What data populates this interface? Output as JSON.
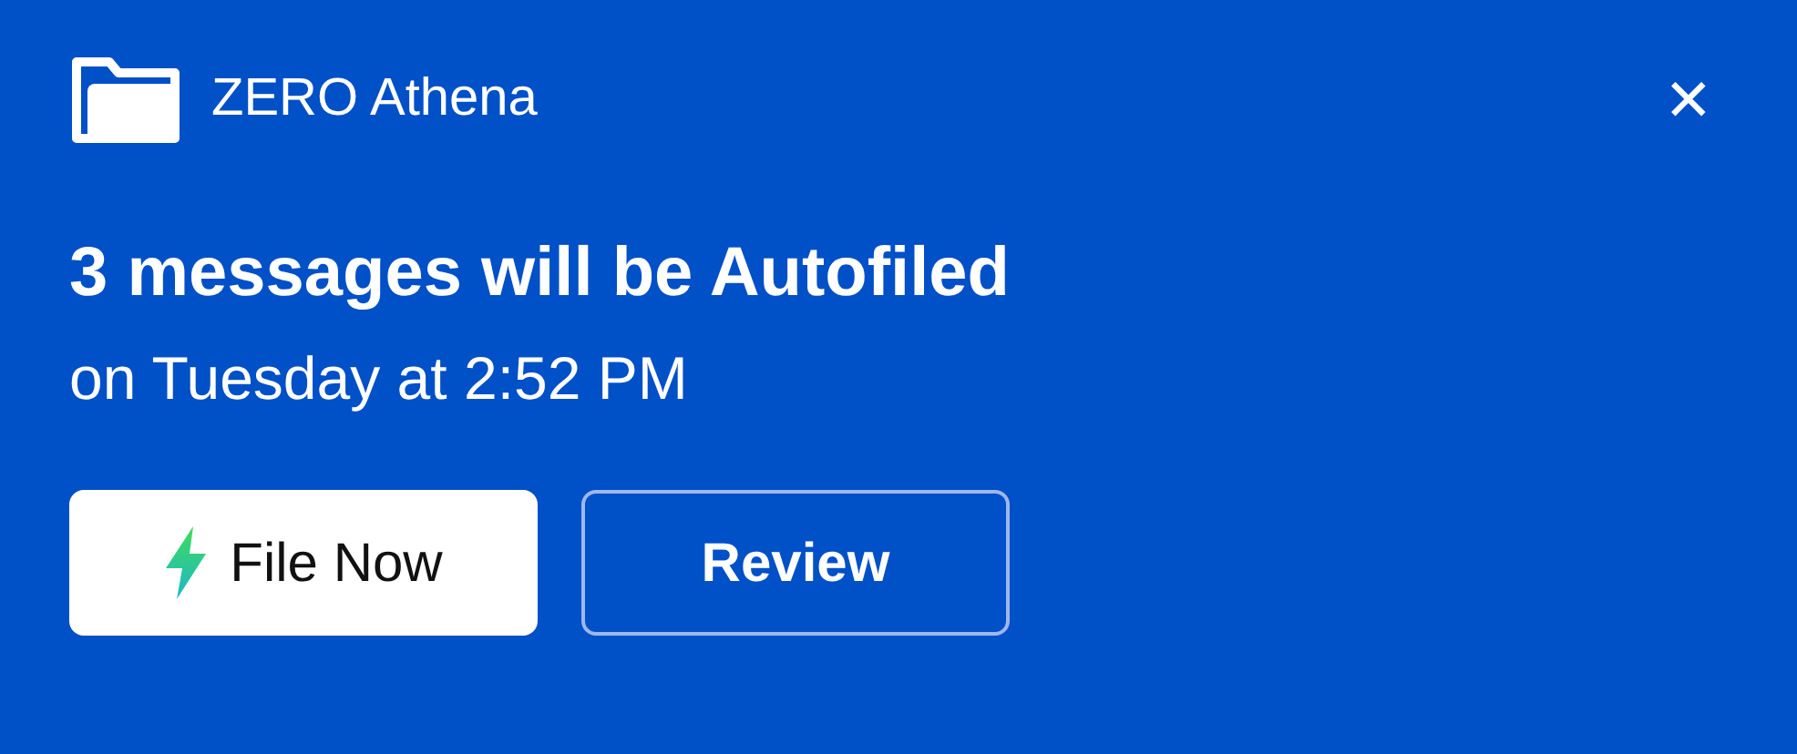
{
  "app": {
    "name": "ZERO Athena"
  },
  "close": {
    "label": "✕"
  },
  "title": "3 messages will be Autofiled",
  "subtitle": "on Tuesday at 2:52 PM",
  "buttons": [
    {
      "label": "File Now",
      "kind": "primary"
    },
    {
      "label": "Review",
      "kind": "outline"
    }
  ]
}
